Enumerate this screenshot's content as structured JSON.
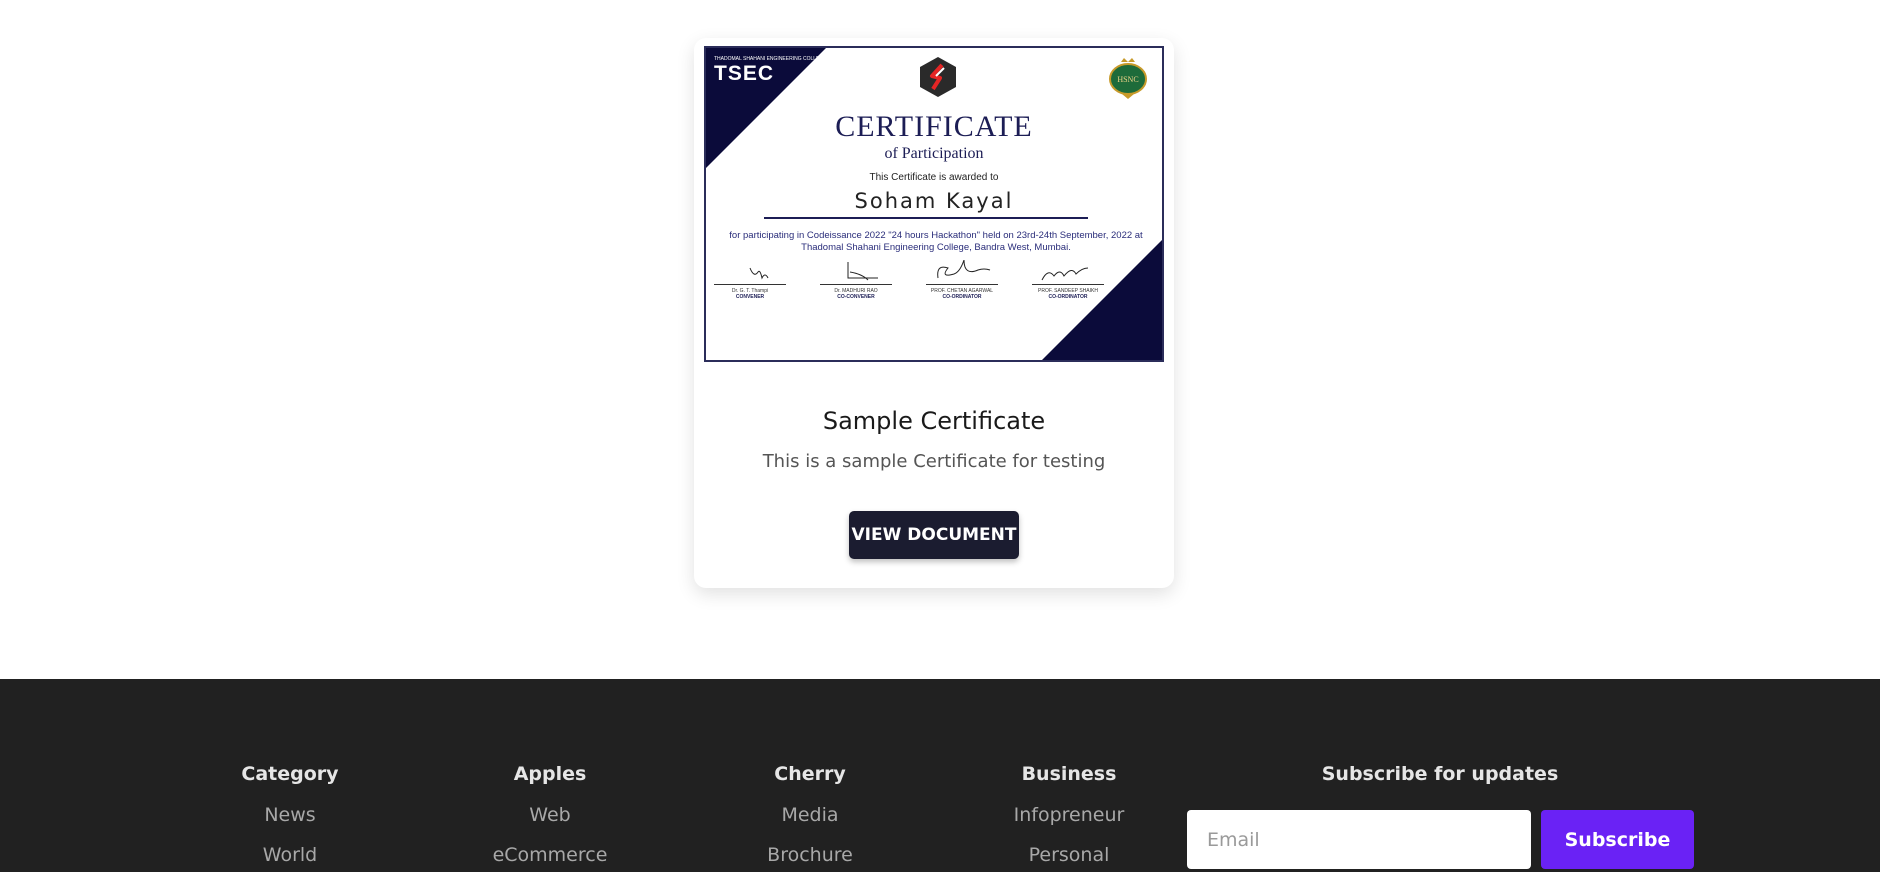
{
  "card": {
    "certificate": {
      "college_abbr": "TSEC",
      "college_name": "THADOMAL SHAHANI ENGINEERING COLLEGE",
      "seal_text": "HSNC",
      "title": "CERTIFICATE",
      "subtitle": "of Participation",
      "awarded_text": "This Certificate is awarded to",
      "recipient": "Soham Kayal",
      "description": "for participating in Codeissance 2022 \"24 hours Hackathon\" held on 23rd-24th September, 2022 at Thadomal Shahani Engineering College, Bandra West, Mumbai.",
      "signatories": [
        {
          "name": "Dr. G. T. Thampi",
          "role": "CONVENER"
        },
        {
          "name": "Dr. MADHURI RAO",
          "role": "CO-CONVENER"
        },
        {
          "name": "PROF. CHETAN AGARWAL",
          "role": "CO-ORDINATOR"
        },
        {
          "name": "PROF. SANDEEP SHAIKH",
          "role": "CO-ORDINATOR"
        }
      ],
      "accent_color": "#0b0b3a"
    },
    "title": "Sample Certificate",
    "text": "This is a sample Certificate for testing",
    "button_label": "VIEW DOCUMENT"
  },
  "footer": {
    "columns": [
      {
        "heading": "Category",
        "links": [
          "News",
          "World"
        ]
      },
      {
        "heading": "Apples",
        "links": [
          "Web",
          "eCommerce"
        ]
      },
      {
        "heading": "Cherry",
        "links": [
          "Media",
          "Brochure"
        ]
      },
      {
        "heading": "Business",
        "links": [
          "Infopreneur",
          "Personal"
        ]
      }
    ],
    "subscribe": {
      "heading": "Subscribe for updates",
      "placeholder": "Email",
      "button_label": "Subscribe",
      "button_color": "#6a22f5"
    },
    "background": "#212121"
  }
}
